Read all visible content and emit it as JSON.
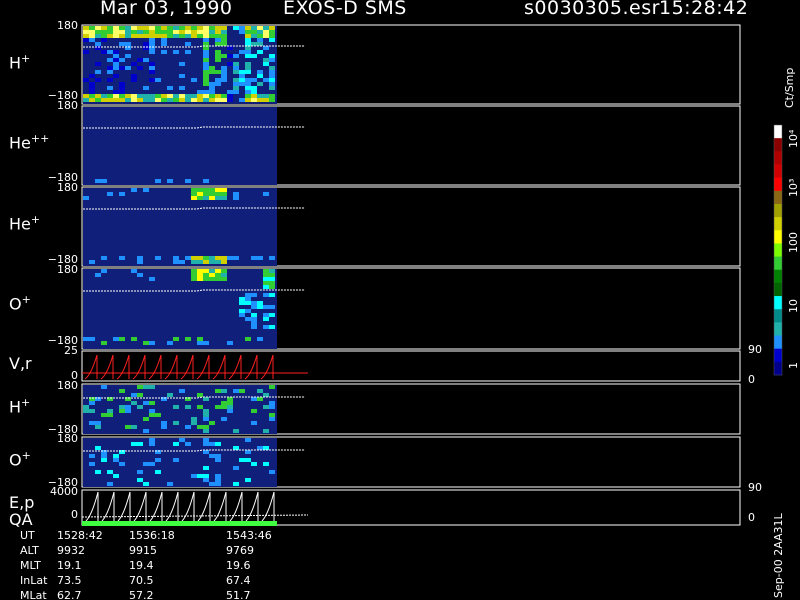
{
  "header": {
    "date": "Mar 03, 1990",
    "instrument": "EXOS-D SMS",
    "file": "s0030305.esr",
    "time": "15:28:42"
  },
  "colorbar": {
    "title": "Ct/Smp",
    "ticks": [
      "10⁴",
      "10³",
      "100",
      "10",
      "1"
    ],
    "colors": [
      "#ffffff",
      "#8b0000",
      "#b00000",
      "#d00000",
      "#ff0000",
      "#8b6914",
      "#a0a000",
      "#d0d000",
      "#ffff00",
      "#7cfc00",
      "#32cd32",
      "#008000",
      "#006400",
      "#00ffff",
      "#008b8b",
      "#20b2aa",
      "#1e90ff",
      "#0000cd",
      "#00008b"
    ]
  },
  "chart_data": [
    {
      "type": "heatmap",
      "panel": "H+",
      "label_base": "H",
      "label_sup": "+",
      "ymax_label": "180",
      "ymin_label": "−180",
      "ylim": [
        -180,
        180
      ]
    },
    {
      "type": "heatmap",
      "panel": "He++",
      "label_base": "He",
      "label_sup": "++",
      "ymax_label": "180",
      "ymin_label": "−180",
      "ylim": [
        -180,
        180
      ]
    },
    {
      "type": "heatmap",
      "panel": "He+",
      "label_base": "He",
      "label_sup": "+",
      "ymax_label": "180",
      "ymin_label": "−180",
      "ylim": [
        -180,
        180
      ]
    },
    {
      "type": "heatmap",
      "panel": "O+",
      "label_base": "O",
      "label_sup": "+",
      "ymax_label": "180",
      "ymin_label": "−180",
      "ylim": [
        -180,
        180
      ]
    },
    {
      "type": "line",
      "panel": "V,r",
      "label_base": "V,r",
      "label_sup": "",
      "ymax_label": "25",
      "ymin_label": "0",
      "right_max": "90",
      "right_min": "0"
    },
    {
      "type": "heatmap",
      "panel": "H+ (2)",
      "label_base": "H",
      "label_sup": "+",
      "ymax_label": "180",
      "ymin_label": "−180",
      "ylim": [
        -180,
        180
      ]
    },
    {
      "type": "heatmap",
      "panel": "O+ (2)",
      "label_base": "O",
      "label_sup": "+",
      "ymax_label": "180",
      "ymin_label": "−180",
      "ylim": [
        -180,
        180
      ]
    },
    {
      "type": "line",
      "panel": "E,p",
      "label_base": "E,p",
      "label_sup": "",
      "ymax_label": "4000",
      "ymin_label": "0",
      "right_max": "90",
      "right_min": "0"
    }
  ],
  "qa_label": "QA",
  "ephemeris": {
    "rows": [
      {
        "name": "UT",
        "values": [
          "1528:42",
          "1536:18",
          "1543:46"
        ]
      },
      {
        "name": "ALT",
        "values": [
          "9932",
          "9915",
          "9769"
        ]
      },
      {
        "name": "MLT",
        "values": [
          "19.1",
          "19.4",
          "19.6"
        ]
      },
      {
        "name": "InLat",
        "values": [
          "73.5",
          "70.5",
          "67.4"
        ]
      },
      {
        "name": "MLat",
        "values": [
          "62.7",
          "57.2",
          "51.7"
        ]
      }
    ]
  },
  "footer_code": "Sep-00 2AA31L"
}
